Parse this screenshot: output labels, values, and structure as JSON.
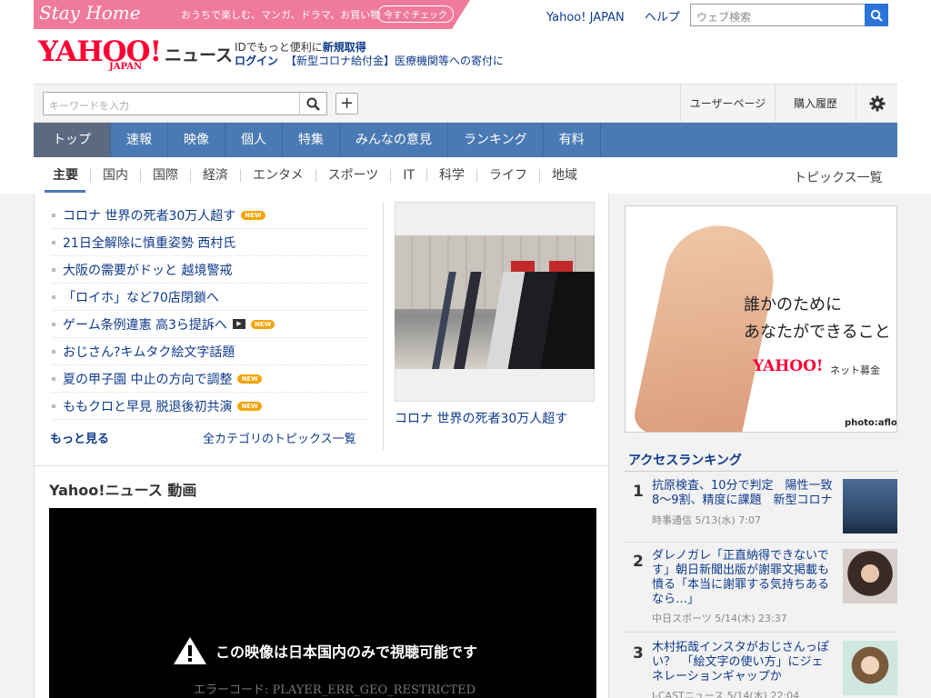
{
  "promo": {
    "logo": "Stay Home",
    "text": "おうちで楽しむ、マンガ、ドラマ、お買い物",
    "button": "今すぐチェック"
  },
  "toplinks": {
    "yahoo_japan": "Yahoo! JAPAN",
    "help": "ヘルプ"
  },
  "web_search": {
    "placeholder": "ウェブ検索"
  },
  "header": {
    "logo": "YAHOO!",
    "logo_sub": "JAPAN",
    "section": "ニュース",
    "line1_prefix": "IDでもっと便利に",
    "line1_link": "新規取得",
    "login": "ログイン",
    "promo_link": "【新型コロナ給付金】医療機関等への寄付に"
  },
  "toolbar": {
    "keyword_placeholder": "キーワードを入力",
    "user_page": "ユーザーページ",
    "purchase_history": "購入履歴"
  },
  "main_nav": [
    "トップ",
    "速報",
    "映像",
    "個人",
    "特集",
    "みんなの意見",
    "ランキング",
    "有料"
  ],
  "sub_nav": [
    "主要",
    "国内",
    "国際",
    "経済",
    "エンタメ",
    "スポーツ",
    "IT",
    "科学",
    "ライフ",
    "地域"
  ],
  "topics_all": "トピックス一覧",
  "topics": [
    {
      "title": "コロナ 世界の死者30万人超す",
      "badge": "NEW",
      "video": false
    },
    {
      "title": "21日全解除に慎重姿勢 西村氏",
      "badge": "",
      "video": false
    },
    {
      "title": "大阪の需要がドッと 越境警戒",
      "badge": "",
      "video": false
    },
    {
      "title": "「ロイホ」など70店閉鎖へ",
      "badge": "",
      "video": false
    },
    {
      "title": "ゲーム条例違憲 高3ら提訴へ",
      "badge": "NEW",
      "video": true
    },
    {
      "title": "おじさん?キムタク絵文字話題",
      "badge": "",
      "video": false
    },
    {
      "title": "夏の甲子園 中止の方向で調整",
      "badge": "NEW",
      "video": false
    },
    {
      "title": "ももクロと早見 脱退後初共演",
      "badge": "NEW",
      "video": false
    }
  ],
  "more": "もっと見る",
  "all_categories": "全カテゴリのトピックス一覧",
  "photo_caption": "コロナ 世界の死者30万人超す",
  "video_section": {
    "title": "Yahoo!ニュース 動画",
    "warning": "この映像は日本国内のみで視聴可能です",
    "error_code": "エラーコード: PLAYER_ERR_GEO_RESTRICTED"
  },
  "ad": {
    "line1": "誰かのために",
    "line2": "あなたができること",
    "logo": "YAHOO!",
    "sub": "ネット募金",
    "credit": "photo:aflo"
  },
  "ranking": {
    "title": "アクセスランキング",
    "items": [
      {
        "num": "1",
        "title": "抗原検査、10分で判定　陽性一致8～9割、精度に課題　新型コロナ",
        "meta": "時事通信 5/13(水) 7:07"
      },
      {
        "num": "2",
        "title": "ダレノガレ「正直納得できないです」朝日新聞出版が謝罪文掲載も憤る「本当に謝罪する気持ちあるなら…」",
        "meta": "中日スポーツ 5/14(木) 23:37"
      },
      {
        "num": "3",
        "title": "木村拓哉インスタがおじさんっぽい？　「絵文字の使い方」にジェネレーションギャップか",
        "meta": "J-CASTニュース 5/14(木) 22:04"
      }
    ]
  },
  "colors": {
    "nav": "#4a7ab3",
    "link": "#0e3a8c",
    "brand": "#ff0033",
    "badge": "#f5a300"
  }
}
